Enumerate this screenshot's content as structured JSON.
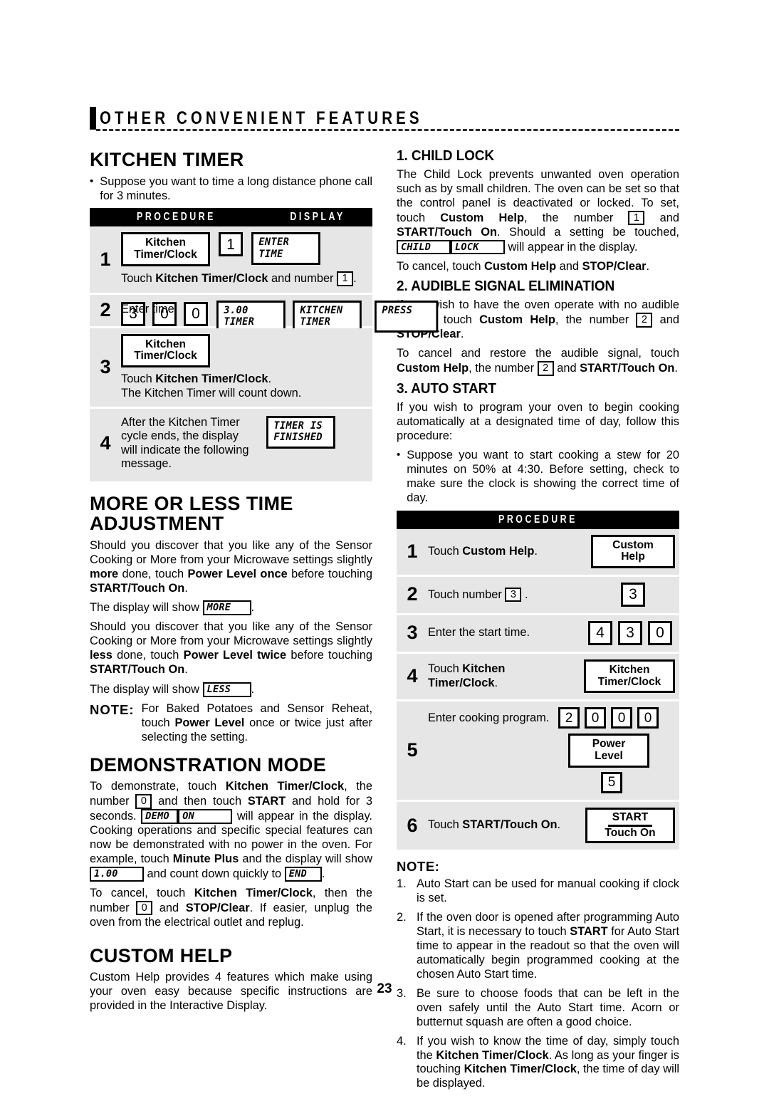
{
  "chapter": {
    "title": "OTHER CONVENIENT FEATURES"
  },
  "page_number": "23",
  "left": {
    "kitchen_timer": {
      "heading": "KITCHEN TIMER",
      "intro": "Suppose you want to time a long distance phone call for 3 minutes.",
      "table": {
        "header_procedure": "PROCEDURE",
        "header_display": "DISPLAY",
        "rows": [
          {
            "step": "1",
            "keys": [
              "Kitchen Timer/Clock",
              "1"
            ],
            "displays": [
              "ENTER TIME"
            ],
            "caption_pre": "Touch ",
            "caption_bold": "Kitchen Timer/Clock",
            "caption_mid": " and number ",
            "caption_key": "1",
            "caption_post": "."
          },
          {
            "step": "2",
            "keys": [
              "3",
              "0",
              "0"
            ],
            "displays": [
              "3.00 TIMER",
              "PRESS",
              "KITCHEN TIMER"
            ],
            "caption": "Enter time."
          },
          {
            "step": "3",
            "keys": [
              "Kitchen Timer/Clock"
            ],
            "caption_pre": "Touch ",
            "caption_bold": "Kitchen Timer/Clock",
            "caption_post": ".",
            "caption_line2": "The Kitchen Timer will count down."
          },
          {
            "step": "4",
            "text": "After the Kitchen Timer cycle ends, the display will indicate the following message.",
            "displays": [
              "TIMER IS FINISHED"
            ]
          }
        ]
      },
      "display_labels": {
        "enter": "ENTER",
        "time": "TIME",
        "three_zero_zero": "3.00",
        "timer": "TIMER",
        "press": "PRESS",
        "kitchen": "KITCHEN",
        "timer2": "TIMER",
        "timer_is": "TIMER IS",
        "finished": "FINISHED"
      },
      "keys": {
        "kitchen": "Kitchen",
        "timer_clock": "Timer/Clock",
        "n1": "1",
        "n3": "3",
        "n0a": "0",
        "n0b": "0"
      }
    },
    "more_less": {
      "heading": "MORE OR LESS TIME ADJUSTMENT",
      "p1_a": "Should you discover that you like any of the Sensor Cooking or More from your Microwave settings slightly ",
      "p1_b": "more",
      "p1_c": " done, touch ",
      "p1_d": "Power Level once",
      "p1_e": " before touching ",
      "p1_f": "START/Touch On",
      "p1_g": ".",
      "show1_pre": "The display will show ",
      "show1_lcd": "MORE",
      "show1_post": ".",
      "p2_a": "Should you discover that you like any of the Sensor Cooking or More from your Microwave settings slightly ",
      "p2_b": "less",
      "p2_c": " done, touch ",
      "p2_d": "Power Level twice",
      "p2_e": " before touching ",
      "p2_f": "START/Touch On",
      "p2_g": ".",
      "show2_pre": "The display will show ",
      "show2_lcd": "LESS",
      "show2_post": ".",
      "note_label": "NOTE:",
      "note_a": "For Baked Potatoes and Sensor Reheat, touch ",
      "note_b": "Power Level",
      "note_c": " once or twice just after selecting the setting."
    },
    "demo": {
      "heading": "DEMONSTRATION MODE",
      "t1": "To demonstrate, touch ",
      "t2": "Kitchen Timer/Clock",
      "t3": ", the number ",
      "key0a": "0",
      "t4": " and then touch ",
      "t5": "START",
      "t6": " and hold for 3 seconds. ",
      "lcd_demo": "DEMO",
      "lcd_on": "ON",
      "t7": " will appear in the display. Cooking operations and specific special features can now be demonstrated with no power in the oven. For example, touch ",
      "t8": "Minute Plus",
      "t9": " and the display will show ",
      "lcd_100": "1.00",
      "t10": " and count down quickly to ",
      "lcd_end": "END",
      "t11": ".",
      "t12": "To cancel, touch ",
      "t13": "Kitchen Timer/Clock",
      "t14": ", then the number ",
      "key0b": "0",
      "t15": " and ",
      "t16": "STOP/Clear",
      "t17": ". If easier, unplug the oven from the electrical outlet and replug."
    },
    "custom_help": {
      "heading": "CUSTOM HELP",
      "body": "Custom Help provides 4 features which make using your oven easy because specific instructions are provided in the Interactive Display."
    }
  },
  "right": {
    "child_lock": {
      "heading": "1. CHILD LOCK",
      "t1": "The Child Lock prevents unwanted oven operation such as by small children. The oven can be set so that the control panel is deactivated or locked. To set, touch ",
      "t2": "Custom Help",
      "t3": ", the number ",
      "key1": "1",
      "t4": " and ",
      "t5": "START/Touch On",
      "t6": ". Should a setting be touched, ",
      "lcd_child": "CHILD",
      "lcd_lock": "LOCK",
      "t7": " will appear in the display.",
      "cancel_pre": "To cancel, touch ",
      "cancel_b1": "Custom Help",
      "cancel_mid": " and ",
      "cancel_b2": "STOP/Clear",
      "cancel_post": "."
    },
    "audible": {
      "heading": "2. AUDIBLE SIGNAL ELIMINATION",
      "t1": "If you wish to have the oven operate with no audible signals, touch ",
      "t2": "Custom Help",
      "t3": ", the number ",
      "key2a": "2",
      "t4": " and ",
      "t5": "STOP/Clear",
      "t6": ".",
      "c1": "To cancel and restore the audible signal, touch ",
      "c2": "Custom Help",
      "c3": ", the number ",
      "key2b": "2",
      "c4": " and ",
      "c5": "START/Touch On",
      "c6": "."
    },
    "auto_start": {
      "heading": "3. AUTO START",
      "intro": "If you wish to program your oven to begin cooking automatically at a designated time of day, follow this procedure:",
      "bullet": "Suppose you want to start cooking a stew for 20 minutes on 50% at 4:30. Before setting, check to make sure the clock is showing the correct  time of day.",
      "table": {
        "header_procedure": "PROCEDURE",
        "rows": [
          {
            "step": "1",
            "pre": "Touch ",
            "bold": "Custom Help",
            "post": ".",
            "key": [
              "Custom",
              "Help"
            ]
          },
          {
            "step": "2",
            "pre": "Touch number ",
            "key_inline": "3",
            "post": " .",
            "keys": [
              "3"
            ]
          },
          {
            "step": "3",
            "text": "Enter the start time.",
            "keys": [
              "4",
              "3",
              "0"
            ]
          },
          {
            "step": "4",
            "pre": "Touch ",
            "bold": "Kitchen Timer/Clock",
            "post": ".",
            "key": [
              "Kitchen",
              "Timer/Clock"
            ]
          },
          {
            "step": "5",
            "text": "Enter cooking program.",
            "keys": [
              "2",
              "0",
              "0",
              "0"
            ],
            "panel": [
              "Power",
              "Level"
            ],
            "level": "5"
          },
          {
            "step": "6",
            "pre": "Touch ",
            "bold": "START/Touch On",
            "post": ".",
            "key": [
              "START",
              "Touch On"
            ]
          }
        ]
      }
    },
    "notes": {
      "heading": "NOTE:",
      "items": [
        {
          "num": "1.",
          "a": "Auto Start can be used for manual cooking if clock is set.",
          "b": "",
          "c": ""
        },
        {
          "num": "2.",
          "a": "If the oven door is opened after programming Auto Start, it is necessary to touch ",
          "b": "START",
          "c": " for Auto Start time to appear in the readout so that the oven will automatically begin programmed  cooking at the chosen Auto Start time."
        },
        {
          "num": "3.",
          "a": "Be sure to choose foods that can be left in the oven safely until the Auto Start time. Acorn or butternut squash are often a good choice.",
          "b": "",
          "c": ""
        },
        {
          "num": "4.",
          "a": "If you wish to know the time of day, simply touch the ",
          "b": "Kitchen Timer/Clock",
          "c": ". As long as your finger is touching ",
          "d": "Kitchen Timer/Clock",
          "e": ", the time of day will be displayed."
        }
      ]
    }
  }
}
